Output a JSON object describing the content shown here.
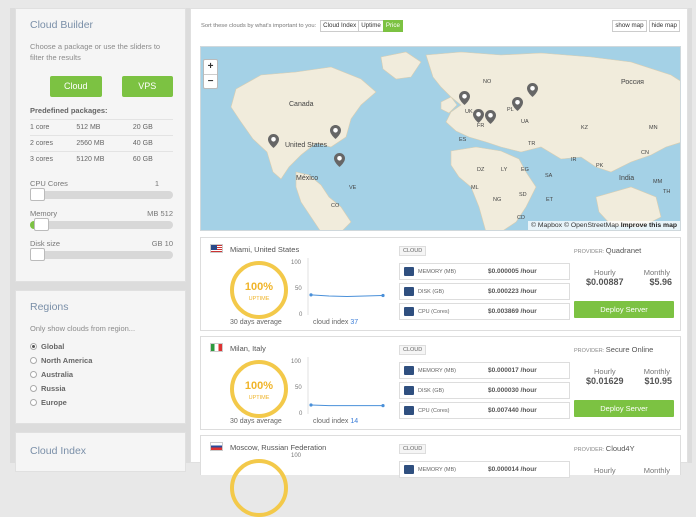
{
  "builder": {
    "title": "Cloud Builder",
    "description": "Choose a package or use the sliders to filter the results",
    "btn_cloud": "Cloud",
    "btn_vps": "VPS",
    "packages_title": "Predefined packages:",
    "packages": [
      {
        "cores": "1 core",
        "mem": "512 MB",
        "disk": "20 GB"
      },
      {
        "cores": "2 cores",
        "mem": "2560 MB",
        "disk": "40 GB"
      },
      {
        "cores": "3 cores",
        "mem": "5120 MB",
        "disk": "60 GB"
      }
    ],
    "cpu_label": "CPU Cores",
    "cpu_value": "1",
    "mem_label": "Memory",
    "mem_unit": "MB",
    "mem_value": "512",
    "disk_label": "Disk size",
    "disk_unit": "GB",
    "disk_value": "10"
  },
  "regions": {
    "title": "Regions",
    "description": "Only show clouds from region...",
    "options": [
      "Global",
      "North America",
      "Australia",
      "Russia",
      "Europe"
    ],
    "selected": "Global"
  },
  "cloud_index": {
    "title": "Cloud Index"
  },
  "toolbar": {
    "sort_label": "Sort these clouds by what's important to you:",
    "sort_buttons": [
      "Cloud Index",
      "Uptime",
      "Price"
    ],
    "active_sort": "Price",
    "show_map": "show map",
    "hide_map": "hide map"
  },
  "map": {
    "zoom_in": "+",
    "zoom_out": "−",
    "labels": [
      "Canada",
      "United States",
      "México",
      "Россия",
      "India",
      "NO",
      "UK",
      "PL",
      "UA",
      "KZ",
      "MN",
      "TR",
      "IR",
      "DZ",
      "LY",
      "EG",
      "SD",
      "ML",
      "NG",
      "SA",
      "ES",
      "FR",
      "PK",
      "CN",
      "VE",
      "CO",
      "ET",
      "CD",
      "MM",
      "TH"
    ],
    "attribution_mapbox": "© Mapbox",
    "attribution_osm": "© OpenStreetMap",
    "improve": "Improve this map"
  },
  "labels": {
    "uptime": "UPTIME",
    "days_avg": "30 days average",
    "cloud_index": "cloud index",
    "cloud_tag": "CLOUD",
    "provider": "PROVIDER:",
    "hourly": "Hourly",
    "monthly": "Monthly",
    "deploy": "Deploy Server",
    "mem": "MEMORY (MB)",
    "disk": "DISK (GB)",
    "cpu": "CPU (Cores)",
    "axis_100": "100",
    "axis_50": "50",
    "axis_0": "0"
  },
  "clouds": [
    {
      "location": "Miami, United States",
      "uptime": "100%",
      "index": "37",
      "provider": "Quadranet",
      "mem_price": "$0.000005 /hour",
      "disk_price": "$0.000223 /hour",
      "cpu_price": "$0.003869 /hour",
      "hourly": "$0.00887",
      "monthly": "$5.96",
      "spark": [
        36,
        34,
        33,
        34,
        35
      ]
    },
    {
      "location": "Milan, Italy",
      "uptime": "100%",
      "index": "14",
      "provider": "Secure Online",
      "mem_price": "$0.000017 /hour",
      "disk_price": "$0.000030 /hour",
      "cpu_price": "$0.007440 /hour",
      "hourly": "$0.01629",
      "monthly": "$10.95",
      "spark": [
        15,
        14,
        14,
        14,
        14
      ]
    },
    {
      "location": "Moscow, Russian Federation",
      "provider": "Cloud4Y",
      "mem_price": "$0.000014 /hour"
    }
  ],
  "colors": {
    "accent": "#7cc242",
    "gauge": "#f3c94a",
    "link": "#3b7dd8",
    "sea": "#a4d1e6",
    "land": "#f1ecdc"
  }
}
